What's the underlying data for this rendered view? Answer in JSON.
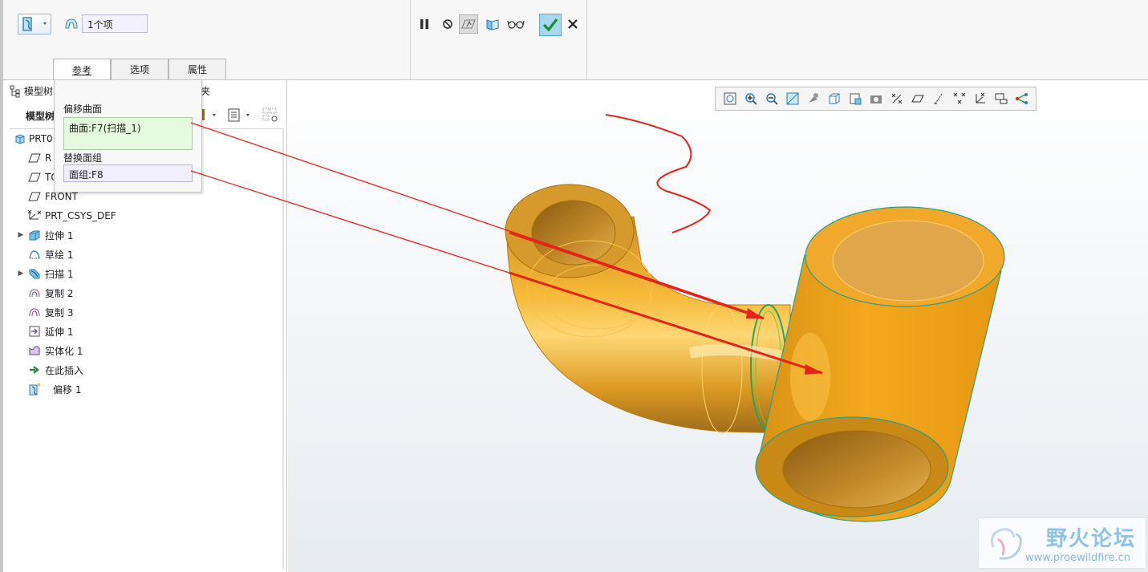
{
  "ribbon": {
    "selection_count": "1个项",
    "tabs": [
      {
        "label": "参考",
        "active": true
      },
      {
        "label": "选项",
        "active": false
      },
      {
        "label": "属性",
        "active": false
      }
    ],
    "offset_type_icon": "replace-offset-icon",
    "controls": [
      "pause-icon",
      "no-preview-icon",
      "feature-preview-icon",
      "verify-icon",
      "glasses-icon",
      "ok-check-icon",
      "cancel-x-icon"
    ]
  },
  "reference_panel": {
    "offset_surface_label": "偏移曲面",
    "offset_surface_value": "曲面:F7(扫描_1)",
    "replace_quilt_label": "替换面组",
    "replace_quilt_value": "面组:F8"
  },
  "model_tree": {
    "header": "模型树",
    "sub_header": "模型树",
    "tab_partial": "夹",
    "items": [
      {
        "label": "PRT0",
        "icon": "part-icon",
        "root": true
      },
      {
        "label": "R",
        "icon": "datum-plane-icon"
      },
      {
        "label": "TO",
        "icon": "datum-plane-icon"
      },
      {
        "label": "FRONT",
        "icon": "datum-plane-icon"
      },
      {
        "label": "PRT_CSYS_DEF",
        "icon": "csys-icon"
      },
      {
        "label": "拉伸 1",
        "icon": "extrude-icon",
        "expandable": true
      },
      {
        "label": "草绘 1",
        "icon": "sketch-icon"
      },
      {
        "label": "扫描 1",
        "icon": "sweep-icon",
        "expandable": true
      },
      {
        "label": "复制 2",
        "icon": "copy-surface-icon"
      },
      {
        "label": "复制 3",
        "icon": "copy-surface-icon"
      },
      {
        "label": "延伸 1",
        "icon": "extend-icon"
      },
      {
        "label": "实体化 1",
        "icon": "solidify-icon"
      },
      {
        "label": "在此插入",
        "icon": "insert-here-arrow-icon"
      },
      {
        "label": "偏移 1",
        "icon": "offset-feature-icon"
      }
    ]
  },
  "view_toolbar": {
    "buttons": [
      "refit-icon",
      "zoom-in-icon",
      "zoom-out-icon",
      "repaint-icon",
      "display-style-icon",
      "saved-views-icon",
      "view-manager-icon",
      "perspective-icon",
      "datum-display-icon",
      "plane-display-icon",
      "axis-display-icon",
      "point-display-icon",
      "csys-display-icon",
      "annotation-display-icon",
      "spin-center-icon"
    ]
  },
  "watermark": {
    "title": "野火论坛",
    "url": "www.proewildfire.cn"
  },
  "colors": {
    "model_fill": "#f0a41c",
    "model_dark": "#c07a0b",
    "edge_green": "#29b26a",
    "annotation_red": "#e4231b",
    "accent_blue": "#5fa9d6"
  }
}
